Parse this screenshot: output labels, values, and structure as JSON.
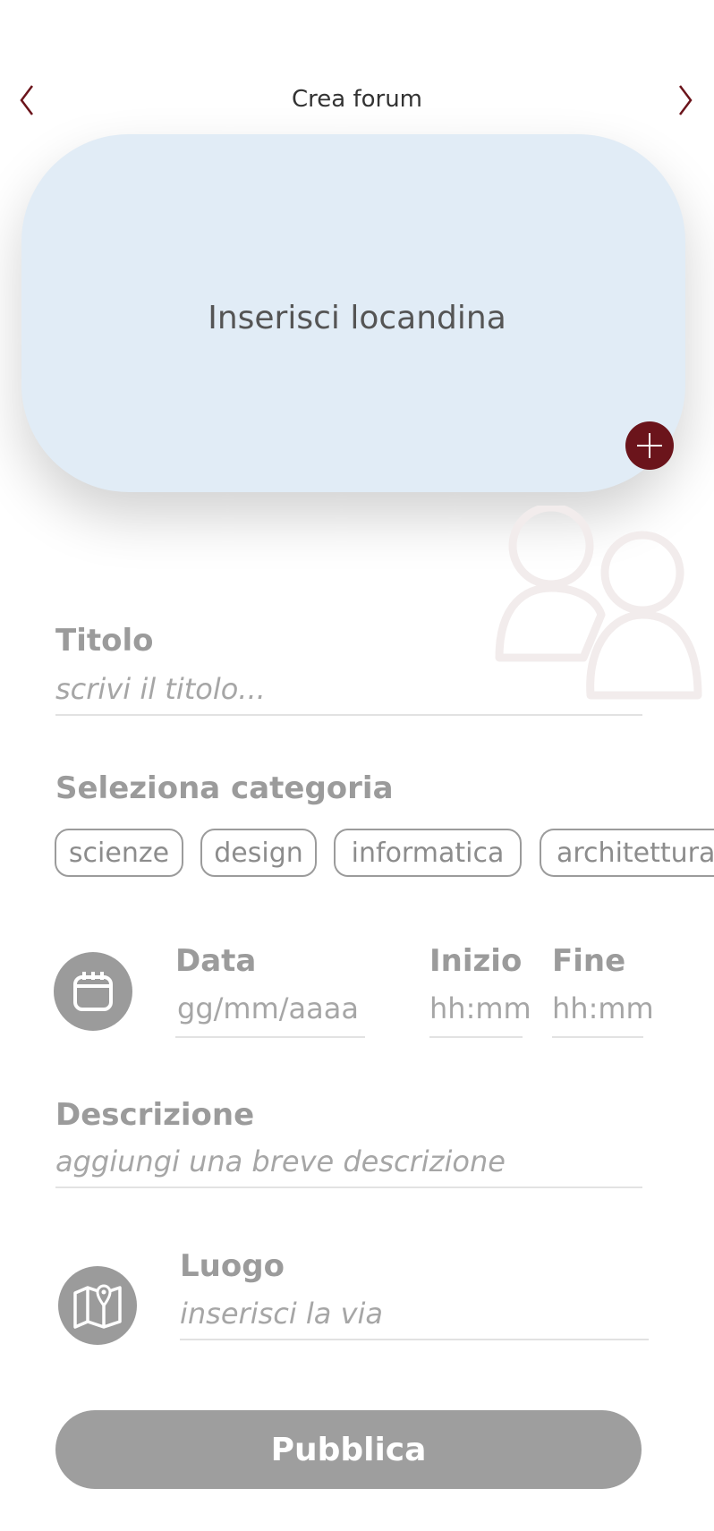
{
  "header": {
    "title": "Crea forum",
    "back_icon": "chevron-left-icon",
    "forward_icon": "chevron-right-icon"
  },
  "poster": {
    "label": "Inserisci locandina",
    "add_icon": "plus-icon"
  },
  "watermark_icon": "users-icon",
  "title_field": {
    "label": "Titolo",
    "placeholder": "scrivi il titolo..."
  },
  "category": {
    "label": "Seleziona categoria",
    "options": [
      "scienze",
      "design",
      "informatica",
      "architettura"
    ]
  },
  "schedule": {
    "icon": "calendar-icon",
    "date_label": "Data",
    "date_placeholder": "gg/mm/aaaa",
    "start_label": "Inizio",
    "start_placeholder": "hh:mm",
    "end_label": "Fine",
    "end_placeholder": "hh:mm"
  },
  "description": {
    "label": "Descrizione",
    "placeholder": "aggiungi una breve descrizione"
  },
  "location": {
    "icon": "map-icon",
    "label": "Luogo",
    "placeholder": "inserisci la via"
  },
  "publish_label": "Pubblica",
  "colors": {
    "accent": "#6b141b",
    "poster_bg": "#e1ecf6",
    "muted": "#9b9b9b"
  }
}
